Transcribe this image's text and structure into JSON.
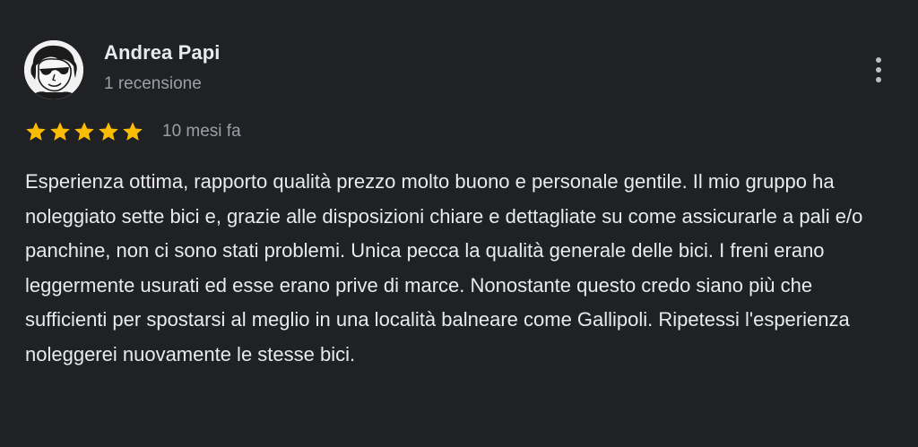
{
  "reviewer": {
    "name": "Andrea Papi",
    "review_count": "1 recensione",
    "avatar_icon": "cartoon-avatar"
  },
  "rating": {
    "stars": 5,
    "max_stars": 5,
    "star_color": "#fbbc04",
    "time": "10 mesi fa"
  },
  "review": {
    "text": "Esperienza ottima, rapporto qualità prezzo molto buono e personale gentile. Il mio gruppo ha noleggiato sette bici e, grazie alle disposizioni chiare e dettagliate su come assicurarle a pali e/o panchine, non ci sono stati problemi. Unica pecca la qualità generale delle bici. I freni erano leggermente usurati ed esse erano prive di marce. Nonostante questo credo siano più che sufficienti per spostarsi al meglio in una località balneare come Gallipoli. Ripetessi l'esperienza noleggerei nuovamente le stesse bici."
  },
  "actions": {
    "more_icon": "more-vert-icon"
  },
  "colors": {
    "background": "#202124",
    "primary_text": "#e8eaed",
    "secondary_text": "#9aa0a6"
  }
}
